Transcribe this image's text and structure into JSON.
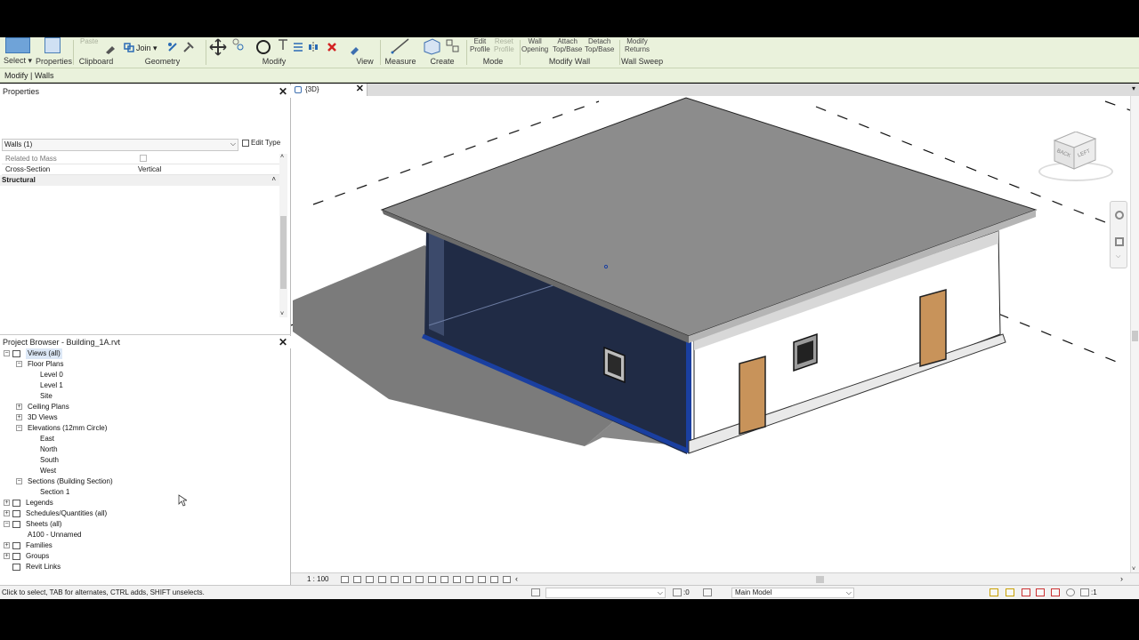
{
  "ribbon": {
    "select": "Select",
    "properties": "Properties",
    "clipboard": "Clipboard",
    "paste": "Paste",
    "join": "Join",
    "geometry": "Geometry",
    "modify_tool": "Modify",
    "modify_group": "Modify",
    "view": "View",
    "measure": "Measure",
    "create": "Create",
    "edit_profile": "Edit\nProfile",
    "reset_profile": "Reset\nProfile",
    "mode": "Mode",
    "wall_opening": "Wall\nOpening",
    "attach_top_base": "Attach\nTop/Base",
    "detach_top_base": "Detach\nTop/Base",
    "modify_wall": "Modify Wall",
    "modify_returns": "Modify\nReturns",
    "wall_sweep": "Wall Sweep"
  },
  "context_bar": "Modify | Walls",
  "properties_panel": {
    "title": "Properties",
    "type_selector": "Walls (1)",
    "edit_type": "Edit Type",
    "rows": [
      {
        "key": "Related to Mass",
        "value": ""
      },
      {
        "key": "Cross-Section",
        "value": "Vertical"
      }
    ],
    "group": "Structural"
  },
  "project_browser": {
    "title": "Project Browser - Building_1A.rvt",
    "items": [
      {
        "label": "Views (all)",
        "toggle": "−",
        "icon": true
      },
      {
        "label": "Floor Plans",
        "toggle": "−"
      },
      {
        "label": "Level 0"
      },
      {
        "label": "Level 1"
      },
      {
        "label": "Site"
      },
      {
        "label": "Ceiling Plans",
        "toggle": "+"
      },
      {
        "label": "3D Views",
        "toggle": "+"
      },
      {
        "label": "Elevations (12mm Circle)",
        "toggle": "−"
      },
      {
        "label": "East"
      },
      {
        "label": "North"
      },
      {
        "label": "South"
      },
      {
        "label": "West"
      },
      {
        "label": "Sections (Building Section)",
        "toggle": "−"
      },
      {
        "label": "Section 1"
      },
      {
        "label": "Legends",
        "toggle": "+",
        "icon": true
      },
      {
        "label": "Schedules/Quantities (all)",
        "toggle": "+",
        "icon": true
      },
      {
        "label": "Sheets (all)",
        "toggle": "−",
        "icon": true
      },
      {
        "label": "A100 - Unnamed"
      },
      {
        "label": "Families",
        "toggle": "+",
        "icon": true
      },
      {
        "label": "Groups",
        "toggle": "+",
        "icon": true
      },
      {
        "label": "Revit Links",
        "icon": true
      }
    ]
  },
  "view_tab": {
    "label": "{3D}"
  },
  "viewcube": {
    "back": "BACK",
    "left": "LEFT"
  },
  "view_control": {
    "scale": "1 : 100"
  },
  "status": {
    "message": "Click to select, TAB for alternates, CTRL adds, SHIFT unselects.",
    "workset_count": ":0",
    "model": "Main Model",
    "filter_count": ":1"
  },
  "colors": {
    "ribbon_bg": "#eaf2dc",
    "selection_blue": "#1a3fa0",
    "roof": "#8c8c8c",
    "door": "#c8935a"
  }
}
